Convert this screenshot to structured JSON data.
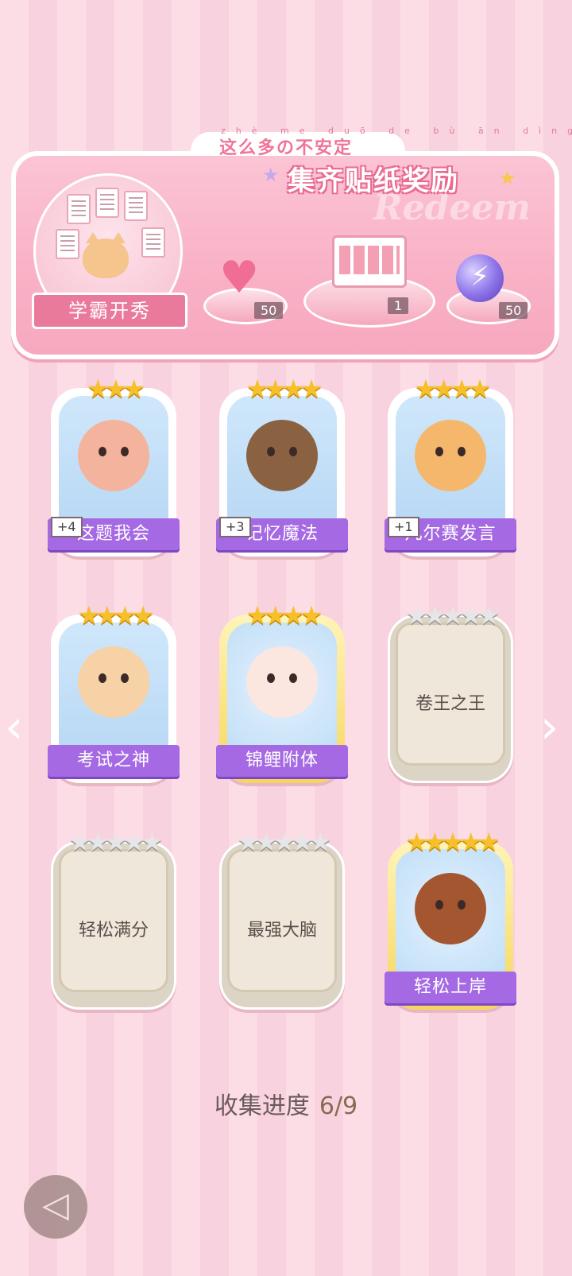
{
  "banner": {
    "pinyin": "zhè me duō de bù ān dìng",
    "slogan": "这么多の不安定",
    "title": "集齐贴纸奖励",
    "watermark": "Redeem",
    "medal_label": "学霸开秀",
    "rewards": [
      {
        "icon": "heart-gem-icon",
        "count": "50"
      },
      {
        "icon": "gift-box-icon",
        "count": "1"
      },
      {
        "icon": "energy-orb-icon",
        "count": "50"
      }
    ]
  },
  "stickers": [
    {
      "name": "这题我会",
      "stars": 3,
      "max_stars": 3,
      "badge": "+4",
      "state": "owned",
      "art": "bear-desk",
      "color": "#f4b39c"
    },
    {
      "name": "记忆魔法",
      "stars": 4,
      "max_stars": 4,
      "badge": "+3",
      "state": "owned",
      "art": "otter-wizard",
      "color": "#8a6242"
    },
    {
      "name": "凡尔赛发言",
      "stars": 4,
      "max_stars": 4,
      "badge": "+1",
      "state": "owned",
      "art": "lion-mic",
      "color": "#f5b76b"
    },
    {
      "name": "考试之神",
      "stars": 4,
      "max_stars": 4,
      "badge": "",
      "state": "owned",
      "art": "angel-cat",
      "color": "#f6d2a6"
    },
    {
      "name": "锦鲤附体",
      "stars": 4,
      "max_stars": 4,
      "badge": "",
      "state": "owned-gold",
      "art": "bear-koi",
      "color": "#fbe6e0"
    },
    {
      "name": "卷王之王",
      "stars": 5,
      "max_stars": 5,
      "badge": "",
      "state": "locked",
      "art": "",
      "color": ""
    },
    {
      "name": "轻松满分",
      "stars": 5,
      "max_stars": 5,
      "badge": "",
      "state": "locked",
      "art": "",
      "color": ""
    },
    {
      "name": "最强大脑",
      "stars": 5,
      "max_stars": 5,
      "badge": "",
      "state": "locked",
      "art": "",
      "color": ""
    },
    {
      "name": "轻松上岸",
      "stars": 5,
      "max_stars": 5,
      "badge": "",
      "state": "owned-gold",
      "art": "squirrel-graduate",
      "color": "#a3562f"
    }
  ],
  "progress": {
    "label": "收集进度",
    "value": "6/9"
  },
  "nav": {
    "prev_icon": "chevron-left-icon",
    "next_icon": "chevron-right-icon",
    "back_icon": "back-arrow-icon"
  }
}
